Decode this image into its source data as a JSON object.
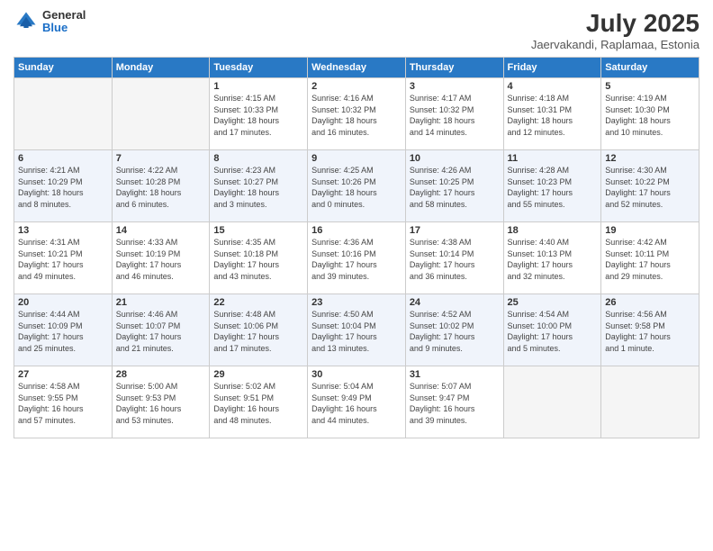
{
  "header": {
    "logo_line1": "General",
    "logo_line2": "Blue",
    "title": "July 2025",
    "subtitle": "Jaervakandi, Raplamaa, Estonia"
  },
  "days_of_week": [
    "Sunday",
    "Monday",
    "Tuesday",
    "Wednesday",
    "Thursday",
    "Friday",
    "Saturday"
  ],
  "weeks": [
    [
      {
        "day": "",
        "info": ""
      },
      {
        "day": "",
        "info": ""
      },
      {
        "day": "1",
        "info": "Sunrise: 4:15 AM\nSunset: 10:33 PM\nDaylight: 18 hours\nand 17 minutes."
      },
      {
        "day": "2",
        "info": "Sunrise: 4:16 AM\nSunset: 10:32 PM\nDaylight: 18 hours\nand 16 minutes."
      },
      {
        "day": "3",
        "info": "Sunrise: 4:17 AM\nSunset: 10:32 PM\nDaylight: 18 hours\nand 14 minutes."
      },
      {
        "day": "4",
        "info": "Sunrise: 4:18 AM\nSunset: 10:31 PM\nDaylight: 18 hours\nand 12 minutes."
      },
      {
        "day": "5",
        "info": "Sunrise: 4:19 AM\nSunset: 10:30 PM\nDaylight: 18 hours\nand 10 minutes."
      }
    ],
    [
      {
        "day": "6",
        "info": "Sunrise: 4:21 AM\nSunset: 10:29 PM\nDaylight: 18 hours\nand 8 minutes."
      },
      {
        "day": "7",
        "info": "Sunrise: 4:22 AM\nSunset: 10:28 PM\nDaylight: 18 hours\nand 6 minutes."
      },
      {
        "day": "8",
        "info": "Sunrise: 4:23 AM\nSunset: 10:27 PM\nDaylight: 18 hours\nand 3 minutes."
      },
      {
        "day": "9",
        "info": "Sunrise: 4:25 AM\nSunset: 10:26 PM\nDaylight: 18 hours\nand 0 minutes."
      },
      {
        "day": "10",
        "info": "Sunrise: 4:26 AM\nSunset: 10:25 PM\nDaylight: 17 hours\nand 58 minutes."
      },
      {
        "day": "11",
        "info": "Sunrise: 4:28 AM\nSunset: 10:23 PM\nDaylight: 17 hours\nand 55 minutes."
      },
      {
        "day": "12",
        "info": "Sunrise: 4:30 AM\nSunset: 10:22 PM\nDaylight: 17 hours\nand 52 minutes."
      }
    ],
    [
      {
        "day": "13",
        "info": "Sunrise: 4:31 AM\nSunset: 10:21 PM\nDaylight: 17 hours\nand 49 minutes."
      },
      {
        "day": "14",
        "info": "Sunrise: 4:33 AM\nSunset: 10:19 PM\nDaylight: 17 hours\nand 46 minutes."
      },
      {
        "day": "15",
        "info": "Sunrise: 4:35 AM\nSunset: 10:18 PM\nDaylight: 17 hours\nand 43 minutes."
      },
      {
        "day": "16",
        "info": "Sunrise: 4:36 AM\nSunset: 10:16 PM\nDaylight: 17 hours\nand 39 minutes."
      },
      {
        "day": "17",
        "info": "Sunrise: 4:38 AM\nSunset: 10:14 PM\nDaylight: 17 hours\nand 36 minutes."
      },
      {
        "day": "18",
        "info": "Sunrise: 4:40 AM\nSunset: 10:13 PM\nDaylight: 17 hours\nand 32 minutes."
      },
      {
        "day": "19",
        "info": "Sunrise: 4:42 AM\nSunset: 10:11 PM\nDaylight: 17 hours\nand 29 minutes."
      }
    ],
    [
      {
        "day": "20",
        "info": "Sunrise: 4:44 AM\nSunset: 10:09 PM\nDaylight: 17 hours\nand 25 minutes."
      },
      {
        "day": "21",
        "info": "Sunrise: 4:46 AM\nSunset: 10:07 PM\nDaylight: 17 hours\nand 21 minutes."
      },
      {
        "day": "22",
        "info": "Sunrise: 4:48 AM\nSunset: 10:06 PM\nDaylight: 17 hours\nand 17 minutes."
      },
      {
        "day": "23",
        "info": "Sunrise: 4:50 AM\nSunset: 10:04 PM\nDaylight: 17 hours\nand 13 minutes."
      },
      {
        "day": "24",
        "info": "Sunrise: 4:52 AM\nSunset: 10:02 PM\nDaylight: 17 hours\nand 9 minutes."
      },
      {
        "day": "25",
        "info": "Sunrise: 4:54 AM\nSunset: 10:00 PM\nDaylight: 17 hours\nand 5 minutes."
      },
      {
        "day": "26",
        "info": "Sunrise: 4:56 AM\nSunset: 9:58 PM\nDaylight: 17 hours\nand 1 minute."
      }
    ],
    [
      {
        "day": "27",
        "info": "Sunrise: 4:58 AM\nSunset: 9:55 PM\nDaylight: 16 hours\nand 57 minutes."
      },
      {
        "day": "28",
        "info": "Sunrise: 5:00 AM\nSunset: 9:53 PM\nDaylight: 16 hours\nand 53 minutes."
      },
      {
        "day": "29",
        "info": "Sunrise: 5:02 AM\nSunset: 9:51 PM\nDaylight: 16 hours\nand 48 minutes."
      },
      {
        "day": "30",
        "info": "Sunrise: 5:04 AM\nSunset: 9:49 PM\nDaylight: 16 hours\nand 44 minutes."
      },
      {
        "day": "31",
        "info": "Sunrise: 5:07 AM\nSunset: 9:47 PM\nDaylight: 16 hours\nand 39 minutes."
      },
      {
        "day": "",
        "info": ""
      },
      {
        "day": "",
        "info": ""
      }
    ]
  ]
}
